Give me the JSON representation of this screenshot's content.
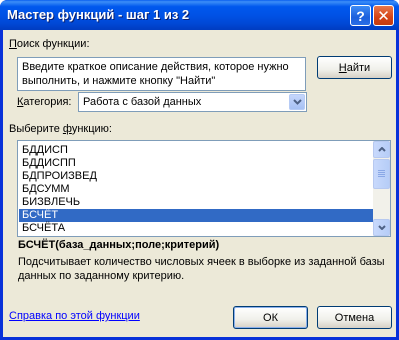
{
  "window": {
    "title": "Мастер функций - шаг 1 из 2",
    "help_btn": "?",
    "close_btn": "✕"
  },
  "search": {
    "label": "Поиск функции:",
    "label_accel": "П",
    "label_rest": "оиск функции:",
    "text": "Введите краткое описание действия, которое нужно выполнить, и нажмите кнопку \"Найти\"",
    "find_button": "Найти",
    "find_accel": "Н",
    "find_rest": "айти"
  },
  "category": {
    "label_accel": "К",
    "label_rest": "атегория:",
    "value": "Работа с базой данных"
  },
  "function_list": {
    "label_pre": "Выберите ",
    "label_accel": "ф",
    "label_rest": "ункцию:",
    "items": [
      "БДДИСП",
      "БДДИСПП",
      "БДПРОИЗВЕД",
      "БДСУММ",
      "БИЗВЛЕЧЬ",
      "БСЧЁТ",
      "БСЧЁТА"
    ],
    "selected": "БСЧЁТ"
  },
  "details": {
    "syntax": "БСЧЁТ(база_данных;поле;критерий)",
    "description": "Подсчитывает количество числовых ячеек в выборке из заданной базы данных по заданному критерию."
  },
  "footer": {
    "help_link": "Справка по этой функции",
    "ok": "ОК",
    "cancel": "Отмена"
  },
  "colors": {
    "title_blue": "#0058ee",
    "dialog_bg": "#ece9d8",
    "selection": "#316ac5",
    "link": "#0000ff"
  },
  "icons": {
    "help": "question-mark-icon",
    "close": "close-icon",
    "dropdown": "chevron-down-icon",
    "scroll_up": "arrow-up-icon",
    "scroll_down": "arrow-down-icon"
  }
}
